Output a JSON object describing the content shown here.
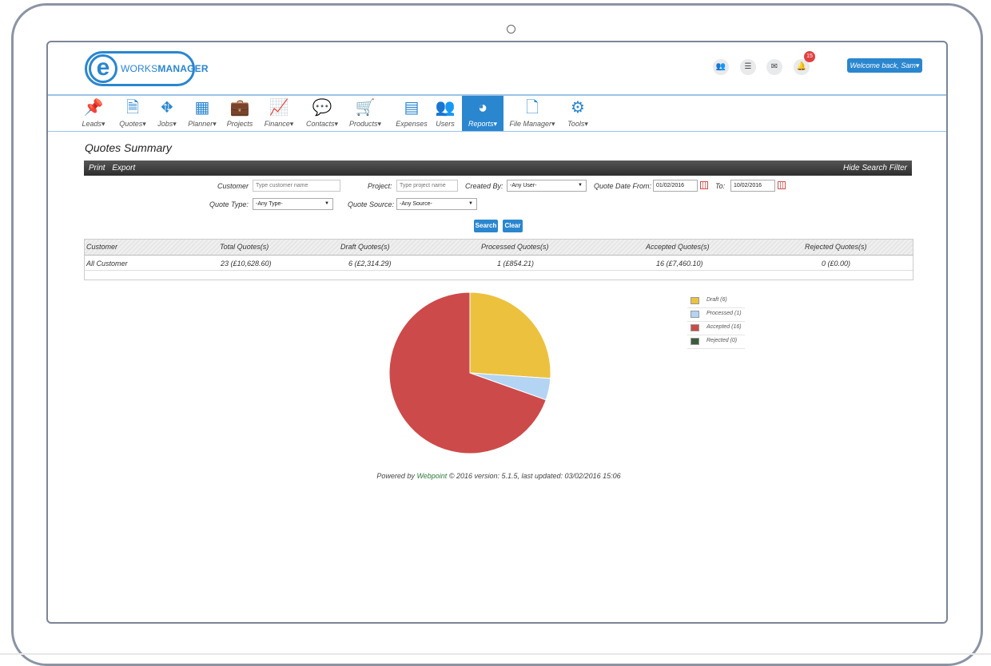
{
  "brand": {
    "logo_letter": "e",
    "name_light": "WORKS",
    "name_bold": "MANAGER"
  },
  "header": {
    "icons": [
      "users-icon",
      "list-icon",
      "mail-icon",
      "bell-icon"
    ],
    "notification_count": "15",
    "welcome": "Welcome back, Sam"
  },
  "nav": {
    "items": [
      {
        "label": "Leads",
        "icon": "pushpin-icon",
        "glyph": "📌",
        "dropdown": true
      },
      {
        "label": "Quotes",
        "icon": "document-icon",
        "glyph": "🗎",
        "dropdown": true
      },
      {
        "label": "Jobs",
        "icon": "road-icon",
        "glyph": "⛖",
        "dropdown": true
      },
      {
        "label": "Planner",
        "icon": "calendar-icon",
        "glyph": "▦",
        "dropdown": true
      },
      {
        "label": "Projects",
        "icon": "briefcase-icon",
        "glyph": "💼",
        "dropdown": false
      },
      {
        "label": "Finance",
        "icon": "line-chart-icon",
        "glyph": "📈",
        "dropdown": true
      },
      {
        "label": "Contacts",
        "icon": "chat-icon",
        "glyph": "💬",
        "dropdown": true
      },
      {
        "label": "Products",
        "icon": "cart-icon",
        "glyph": "🛒",
        "dropdown": true
      },
      {
        "label": "Expenses",
        "icon": "calculator-icon",
        "glyph": "▤",
        "dropdown": false
      },
      {
        "label": "Users",
        "icon": "users-icon",
        "glyph": "👥",
        "dropdown": false
      },
      {
        "label": "Reports",
        "icon": "pie-chart-icon",
        "glyph": "◕",
        "dropdown": true,
        "active": true
      },
      {
        "label": "File Manager",
        "icon": "pdf-file-icon",
        "glyph": "🗋",
        "dropdown": true
      },
      {
        "label": "Tools",
        "icon": "cogs-icon",
        "glyph": "⚙",
        "dropdown": true
      }
    ]
  },
  "page": {
    "title": "Quotes Summary"
  },
  "toolbar": {
    "print": "Print",
    "export": "Export",
    "hide_filter": "Hide Search Filter"
  },
  "filters": {
    "customer_label": "Customer",
    "customer_placeholder": "Type customer name",
    "project_label": "Project:",
    "project_placeholder": "Type project name",
    "created_by_label": "Created By:",
    "created_by_value": "-Any User-",
    "date_from_label": "Quote Date From:",
    "date_from_value": "01/02/2016",
    "date_to_label": "To:",
    "date_to_value": "10/02/2016",
    "quote_type_label": "Quote Type:",
    "quote_type_value": "-Any Type-",
    "quote_source_label": "Quote Source:",
    "quote_source_value": "-Any Source-",
    "search_button": "Search",
    "clear_button": "Clear"
  },
  "table": {
    "headers": [
      "Customer",
      "Total Quotes(s)",
      "Draft Quotes(s)",
      "Processed Quotes(s)",
      "Accepted Quotes(s)",
      "Rejected Quotes(s)"
    ],
    "rows": [
      [
        "All Customer",
        "23 (£10,628.60)",
        "6 (£2,314.29)",
        "1 (£854.21)",
        "16 (£7,460.10)",
        "0 (£0.00)"
      ]
    ]
  },
  "chart_data": {
    "type": "pie",
    "slices": [
      {
        "label": "Draft (6)",
        "value": 6,
        "color": "#ecc13e"
      },
      {
        "label": "Processed (1)",
        "value": 1,
        "color": "#b3d4f2"
      },
      {
        "label": "Accepted (16)",
        "value": 16,
        "color": "#cd4a4a"
      },
      {
        "label": "Rejected (0)",
        "value": 0,
        "color": "#3e5a3e"
      }
    ],
    "legend_position": "right"
  },
  "footer": {
    "prefix": "Powered by",
    "link": "Webpoint",
    "suffix": "© 2016 version: 5.1.5, last updated: 03/02/2016 15:06"
  }
}
